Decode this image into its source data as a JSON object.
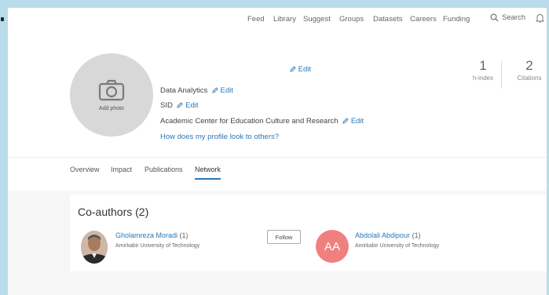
{
  "nav": {
    "items": [
      "Feed",
      "Library",
      "Suggest",
      "Groups",
      "Datasets",
      "Careers",
      "Funding"
    ],
    "search_label": "Search"
  },
  "profile": {
    "add_photo_label": "Add photo",
    "name_edit_label": "Edit",
    "research_field": "Data Analytics",
    "research_field_edit": "Edit",
    "institution_short": "SID",
    "institution_short_edit": "Edit",
    "institution": "Academic Center for Education Culture and Research",
    "institution_edit": "Edit",
    "look_link": "How does my profile look to others?"
  },
  "metrics": [
    {
      "value": "1",
      "label": "h-index"
    },
    {
      "value": "2",
      "label": "Citations"
    }
  ],
  "tabs": [
    "Overview",
    "Impact",
    "Publications",
    "Network"
  ],
  "active_tab": "Network",
  "coauthors": {
    "title": "Co-authors (2)",
    "follow_label": "Follow",
    "items": [
      {
        "name": "Gholamreza Moradi",
        "count": "(1)",
        "affiliation": "Amirkabir University of Technology"
      },
      {
        "name": "Abdolali Abdipour",
        "count": "(1)",
        "affiliation": "Amirkabir University of Technology",
        "initials": "AA"
      }
    ]
  },
  "colors": {
    "accent": "#2a77b8",
    "initials_avatar": "#f08080",
    "outer_background": "#b9dcea"
  }
}
